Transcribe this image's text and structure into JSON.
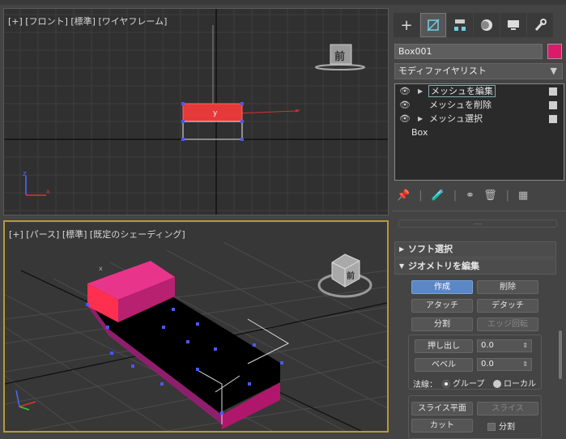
{
  "viewport_top": {
    "label": "[+] [フロント] [標準] [ワイヤフレーム]",
    "viewcube_label": "前"
  },
  "viewport_bottom": {
    "label": "[+] [パース] [標準] [既定のシェーディング]",
    "viewcube_label": "前"
  },
  "object": {
    "name": "Box001",
    "color": "#d81c6a"
  },
  "modifier_list": {
    "label": "モディファイヤリスト"
  },
  "stack": [
    {
      "label": "メッシュを編集",
      "eye": true,
      "expand": true,
      "selected": true
    },
    {
      "label": "メッシュを削除",
      "eye": true,
      "expand": false,
      "selected": false
    },
    {
      "label": "メッシュ選択",
      "eye": true,
      "expand": true,
      "selected": false
    },
    {
      "label": "Box",
      "eye": false,
      "expand": false,
      "selected": false
    }
  ],
  "rollouts": {
    "soft_select": "ソフト選択",
    "edit_geometry": "ジオメトリを編集"
  },
  "buttons": {
    "create": "作成",
    "delete": "削除",
    "attach": "アタッチ",
    "detach": "デタッチ",
    "divide": "分割",
    "edge_turn": "エッジ回転",
    "extrude": "押し出し",
    "bevel": "ベベル",
    "slice_plane": "スライス平面",
    "slice": "スライス",
    "cut": "カット"
  },
  "spinners": {
    "extrude_value": "0.0",
    "bevel_value": "0.0"
  },
  "normals": {
    "label": "法線：",
    "group": "グループ",
    "local": "ローカル",
    "selected": "グループ"
  },
  "split_checkbox": {
    "label": "分割",
    "checked": false
  }
}
